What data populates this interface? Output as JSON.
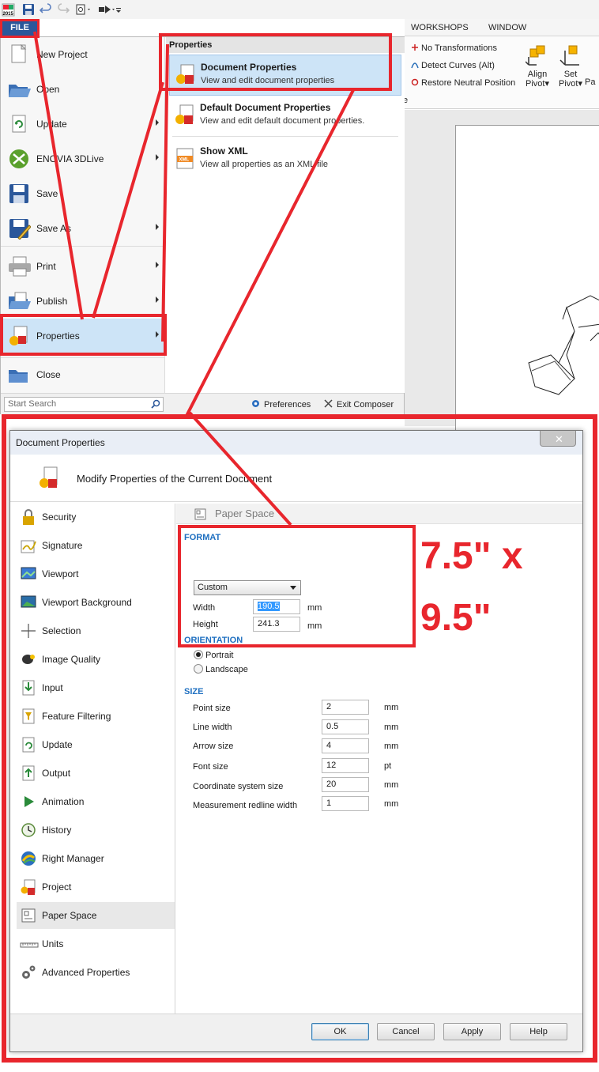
{
  "app": {
    "year_badge": "2015",
    "file_tab": "FILE",
    "ribbon_tabs": [
      "WORKSHOPS",
      "WINDOW"
    ],
    "ribbon_items": [
      "No Transformations",
      "Detect Curves (Alt)",
      "Restore Neutral Position"
    ],
    "align_pivot": [
      "Align",
      "Pivot▾"
    ],
    "set_pivot": [
      "Set",
      "Pivot▾"
    ],
    "partial_label": "Pa",
    "partial_e": "e"
  },
  "file_menu": {
    "items": [
      {
        "label": "New Project",
        "icon": "new-project-icon",
        "has_arrow": false
      },
      {
        "label": "Open",
        "icon": "folder-open-icon",
        "has_arrow": false
      },
      {
        "label": "Update",
        "icon": "update-icon",
        "has_arrow": true
      },
      {
        "label": "ENOVIA 3DLive",
        "icon": "enovia-icon",
        "has_arrow": true
      },
      {
        "label": "Save",
        "icon": "save-icon",
        "has_arrow": false
      },
      {
        "label": "Save As",
        "icon": "save-as-icon",
        "has_arrow": true
      },
      {
        "label": "Print",
        "icon": "printer-icon",
        "has_arrow": true
      },
      {
        "label": "Publish",
        "icon": "publish-icon",
        "has_arrow": true
      },
      {
        "label": "Properties",
        "icon": "properties-icon",
        "has_arrow": true
      },
      {
        "label": "Close",
        "icon": "close-folder-icon",
        "has_arrow": false
      }
    ],
    "search_placeholder": "Start Search",
    "preferences": "Preferences",
    "exit": "Exit Composer"
  },
  "submenu": {
    "header": "Properties",
    "items": [
      {
        "title": "Document Properties",
        "desc": "View and edit document properties"
      },
      {
        "title": "Default Document Properties",
        "desc": "View and edit default document properties."
      },
      {
        "title": "Show XML",
        "desc": "View all properties as an XML file"
      }
    ]
  },
  "dialog": {
    "title": "Document Properties",
    "heading": "Modify Properties of the Current Document",
    "nav": [
      "Security",
      "Signature",
      "Viewport",
      "Viewport Background",
      "Selection",
      "Image Quality",
      "Input",
      "Feature Filtering",
      "Update",
      "Output",
      "Animation",
      "History",
      "Right Manager",
      "Project",
      "Paper Space",
      "Units",
      "Advanced Properties"
    ],
    "selected_nav": "Paper Space",
    "section_title": "Paper Space",
    "format": {
      "label": "FORMAT",
      "select_value": "Custom",
      "width_label": "Width",
      "width_value": "190.5",
      "height_label": "Height",
      "height_value": "241.3",
      "unit": "mm"
    },
    "orientation": {
      "label": "ORIENTATION",
      "portrait": "Portrait",
      "landscape": "Landscape",
      "selected": "Portrait"
    },
    "size": {
      "label": "SIZE",
      "rows": [
        {
          "label": "Point size",
          "value": "2",
          "unit": "mm"
        },
        {
          "label": "Line width",
          "value": "0.5",
          "unit": "mm"
        },
        {
          "label": "Arrow size",
          "value": "4",
          "unit": "mm"
        },
        {
          "label": "Font size",
          "value": "12",
          "unit": "pt"
        },
        {
          "label": "Coordinate system size",
          "value": "20",
          "unit": "mm"
        },
        {
          "label": "Measurement redline width",
          "value": "1",
          "unit": "mm"
        }
      ]
    },
    "buttons": {
      "ok": "OK",
      "cancel": "Cancel",
      "apply": "Apply",
      "help": "Help"
    }
  },
  "annotation": {
    "line1": "7.5\" x",
    "line2": "9.5\"",
    "color": "#e8262d"
  }
}
